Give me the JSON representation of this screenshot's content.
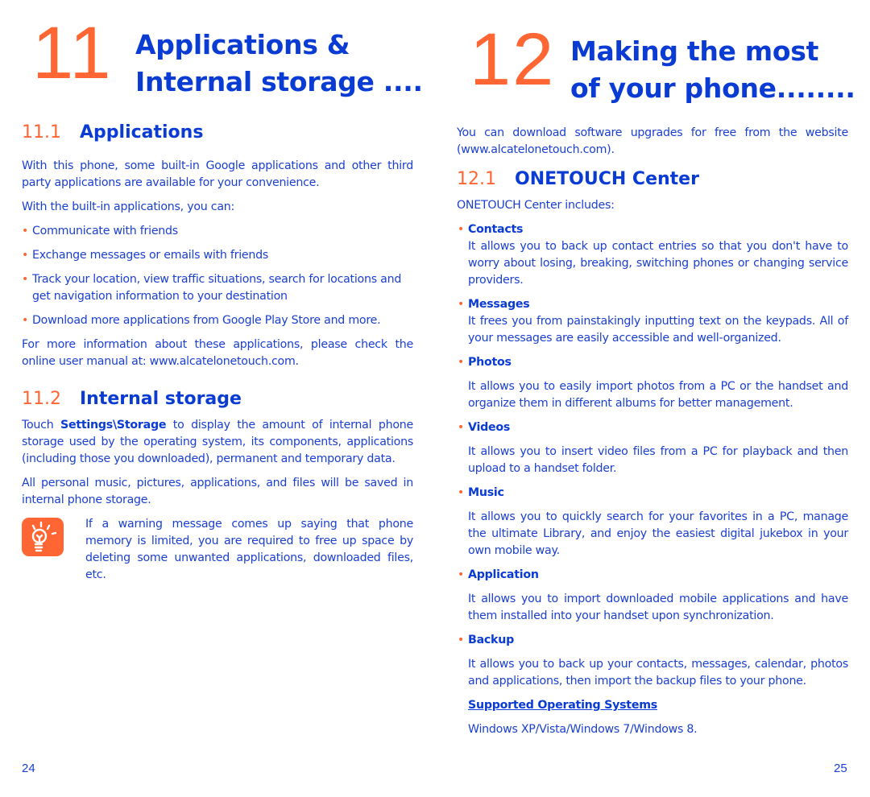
{
  "left_page": {
    "chapter_number": "11",
    "chapter_title_line1": "Applications &",
    "chapter_title_line2": "Internal storage ....",
    "section_1": {
      "number": "11.1",
      "title": "Applications",
      "intro": "With this phone, some built-in Google applications and other third party applications are available for your convenience.",
      "lead": "With the built-in applications, you can:",
      "bullets": [
        "Communicate with friends",
        "Exchange messages or emails with friends",
        "Track your location, view traffic situations, search for locations and get navigation information to your destination",
        "Download more applications from Google Play Store and more."
      ],
      "more_info": "For more information about these applications, please check the online user manual at: www.alcatelonetouch.com."
    },
    "section_2": {
      "number": "11.2",
      "title": "Internal storage",
      "para1_prefix": "Touch ",
      "para1_bold": "Settings\\Storage",
      "para1_suffix": " to display the amount of internal phone storage used by the operating system, its components, applications (including those you downloaded), permanent and temporary data.",
      "para2": "All personal music, pictures, applications, and files will be saved in internal phone storage.",
      "tip_icon": "lightbulb-icon",
      "tip_text": "If a warning message comes up saying that phone memory is limited, you are required to free up space by deleting some unwanted applications, downloaded files, etc."
    },
    "page_number": "24"
  },
  "right_page": {
    "chapter_number": "12",
    "chapter_title_line1": "Making the most",
    "chapter_title_line2": "of your phone........",
    "intro": "You can download software upgrades for free from the website (www.alcatelonetouch.com).",
    "section_1": {
      "number": "12.1",
      "title": "ONETOUCH Center",
      "lead": "ONETOUCH Center includes:",
      "items": [
        {
          "title": "Contacts",
          "text": "It allows you to back up contact entries so that you don't have to worry about losing, breaking, switching phones or changing service providers."
        },
        {
          "title": "Messages",
          "text": "It frees you from painstakingly inputting text on the keypads. All of your messages are easily accessible and well-organized."
        },
        {
          "title": "Photos",
          "text": "It allows you to easily import photos from a PC or the handset and organize them in different albums for better management."
        },
        {
          "title": "Videos",
          "text": "It allows you to insert video files from a PC for playback and then upload to a handset folder."
        },
        {
          "title": "Music",
          "text": "It allows you to quickly search for your favorites in a PC, manage the ultimate Library, and enjoy the easiest digital jukebox in your own mobile way."
        },
        {
          "title": "Application",
          "text": "It allows you to import downloaded mobile applications and have them installed into your handset upon synchronization."
        },
        {
          "title": "Backup",
          "text": "It allows you to back up your contacts, messages, calendar, photos and applications, then import the backup files to your phone."
        }
      ],
      "supported_os_heading": "Supported Operating Systems",
      "supported_os_text": "Windows XP/Vista/Windows 7/Windows 8."
    },
    "page_number": "25"
  },
  "colors": {
    "accent_orange": "#ff6633",
    "heading_blue": "#0a3bd3",
    "body_blue": "#1a3fd1"
  }
}
